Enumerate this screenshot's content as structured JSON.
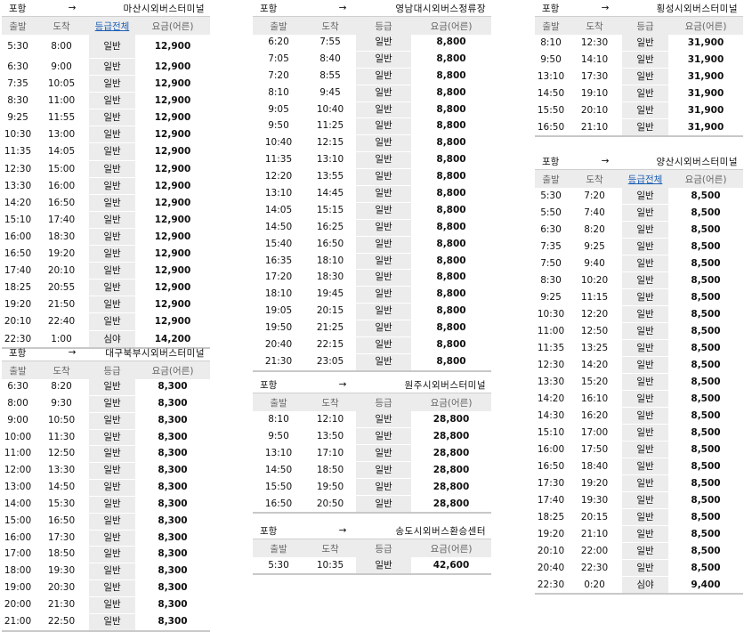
{
  "columns": {
    "dep": "출발",
    "arr": "도착",
    "grade": "등급",
    "grade_all": "등급전체",
    "fare": "요금(어른)"
  },
  "arrow": "→",
  "tables": [
    {
      "from": "포항",
      "dest": "마산시외버스터미널",
      "grade_link": true,
      "rows": [
        [
          "5:30",
          "8:00",
          "일반",
          "12,900"
        ],
        [
          "6:30",
          "9:00",
          "일반",
          "12,900"
        ],
        [
          "7:35",
          "10:05",
          "일반",
          "12,900"
        ],
        [
          "8:30",
          "11:00",
          "일반",
          "12,900"
        ],
        [
          "9:25",
          "11:55",
          "일반",
          "12,900"
        ],
        [
          "10:30",
          "13:00",
          "일반",
          "12,900"
        ],
        [
          "11:35",
          "14:05",
          "일반",
          "12,900"
        ],
        [
          "12:30",
          "15:00",
          "일반",
          "12,900"
        ],
        [
          "13:30",
          "16:00",
          "일반",
          "12,900"
        ],
        [
          "14:20",
          "16:50",
          "일반",
          "12,900"
        ],
        [
          "15:10",
          "17:40",
          "일반",
          "12,900"
        ],
        [
          "16:00",
          "18:30",
          "일반",
          "12,900"
        ],
        [
          "16:50",
          "19:20",
          "일반",
          "12,900"
        ],
        [
          "17:40",
          "20:10",
          "일반",
          "12,900"
        ],
        [
          "18:25",
          "20:55",
          "일반",
          "12,900"
        ],
        [
          "19:20",
          "21:50",
          "일반",
          "12,900"
        ],
        [
          "20:10",
          "22:40",
          "일반",
          "12,900"
        ],
        [
          "22:30",
          "1:00",
          "심야",
          "14,200"
        ]
      ]
    },
    {
      "from": "포항",
      "dest": "대구북부시외버스터미널",
      "grade_link": false,
      "rows": [
        [
          "6:30",
          "8:20",
          "일반",
          "8,300"
        ],
        [
          "8:00",
          "9:30",
          "일반",
          "8,300"
        ],
        [
          "9:00",
          "10:50",
          "일반",
          "8,300"
        ],
        [
          "10:00",
          "11:30",
          "일반",
          "8,300"
        ],
        [
          "11:00",
          "12:50",
          "일반",
          "8,300"
        ],
        [
          "12:00",
          "13:30",
          "일반",
          "8,300"
        ],
        [
          "13:00",
          "14:50",
          "일반",
          "8,300"
        ],
        [
          "14:00",
          "15:30",
          "일반",
          "8,300"
        ],
        [
          "15:00",
          "16:50",
          "일반",
          "8,300"
        ],
        [
          "16:00",
          "17:30",
          "일반",
          "8,300"
        ],
        [
          "17:00",
          "18:50",
          "일반",
          "8,300"
        ],
        [
          "18:00",
          "19:30",
          "일반",
          "8,300"
        ],
        [
          "19:00",
          "20:30",
          "일반",
          "8,300"
        ],
        [
          "20:00",
          "21:30",
          "일반",
          "8,300"
        ],
        [
          "21:00",
          "22:50",
          "일반",
          "8,300"
        ]
      ]
    },
    {
      "from": "포항",
      "dest": "영남대시외버스정류장",
      "grade_link": false,
      "rows": [
        [
          "6:20",
          "7:55",
          "일반",
          "8,800"
        ],
        [
          "7:05",
          "8:40",
          "일반",
          "8,800"
        ],
        [
          "7:20",
          "8:55",
          "일반",
          "8,800"
        ],
        [
          "8:10",
          "9:45",
          "일반",
          "8,800"
        ],
        [
          "9:05",
          "10:40",
          "일반",
          "8,800"
        ],
        [
          "9:50",
          "11:25",
          "일반",
          "8,800"
        ],
        [
          "10:40",
          "12:15",
          "일반",
          "8,800"
        ],
        [
          "11:35",
          "13:10",
          "일반",
          "8,800"
        ],
        [
          "12:20",
          "13:55",
          "일반",
          "8,800"
        ],
        [
          "13:10",
          "14:45",
          "일반",
          "8,800"
        ],
        [
          "14:05",
          "15:15",
          "일반",
          "8,800"
        ],
        [
          "14:50",
          "16:25",
          "일반",
          "8,800"
        ],
        [
          "15:40",
          "16:50",
          "일반",
          "8,800"
        ],
        [
          "16:35",
          "18:10",
          "일반",
          "8,800"
        ],
        [
          "17:20",
          "18:30",
          "일반",
          "8,800"
        ],
        [
          "18:10",
          "19:45",
          "일반",
          "8,800"
        ],
        [
          "19:05",
          "20:15",
          "일반",
          "8,800"
        ],
        [
          "19:50",
          "21:25",
          "일반",
          "8,800"
        ],
        [
          "20:40",
          "22:15",
          "일반",
          "8,800"
        ],
        [
          "21:30",
          "23:05",
          "일반",
          "8,800"
        ]
      ]
    },
    {
      "from": "포항",
      "dest": "원주시외버스터미널",
      "grade_link": false,
      "rows": [
        [
          "8:10",
          "12:10",
          "일반",
          "28,800"
        ],
        [
          "9:50",
          "13:50",
          "일반",
          "28,800"
        ],
        [
          "13:10",
          "17:10",
          "일반",
          "28,800"
        ],
        [
          "14:50",
          "18:50",
          "일반",
          "28,800"
        ],
        [
          "15:50",
          "19:50",
          "일반",
          "28,800"
        ],
        [
          "16:50",
          "20:50",
          "일반",
          "28,800"
        ]
      ]
    },
    {
      "from": "포항",
      "dest": "송도시외버스환승센터",
      "grade_link": false,
      "rows": [
        [
          "5:30",
          "10:35",
          "일반",
          "42,600"
        ]
      ]
    },
    {
      "from": "포항",
      "dest": "횡성시외버스터미널",
      "grade_link": false,
      "rows": [
        [
          "8:10",
          "12:30",
          "일반",
          "31,900"
        ],
        [
          "9:50",
          "14:10",
          "일반",
          "31,900"
        ],
        [
          "13:10",
          "17:30",
          "일반",
          "31,900"
        ],
        [
          "14:50",
          "19:10",
          "일반",
          "31,900"
        ],
        [
          "15:50",
          "20:10",
          "일반",
          "31,900"
        ],
        [
          "16:50",
          "21:10",
          "일반",
          "31,900"
        ]
      ]
    },
    {
      "from": "포항",
      "dest": "양산시외버스터미널",
      "grade_link": true,
      "rows": [
        [
          "5:30",
          "7:20",
          "일반",
          "8,500"
        ],
        [
          "5:50",
          "7:40",
          "일반",
          "8,500"
        ],
        [
          "6:30",
          "8:20",
          "일반",
          "8,500"
        ],
        [
          "7:35",
          "9:25",
          "일반",
          "8,500"
        ],
        [
          "7:50",
          "9:40",
          "일반",
          "8,500"
        ],
        [
          "8:30",
          "10:20",
          "일반",
          "8,500"
        ],
        [
          "9:25",
          "11:15",
          "일반",
          "8,500"
        ],
        [
          "10:30",
          "12:20",
          "일반",
          "8,500"
        ],
        [
          "11:00",
          "12:50",
          "일반",
          "8,500"
        ],
        [
          "11:35",
          "13:25",
          "일반",
          "8,500"
        ],
        [
          "12:30",
          "14:20",
          "일반",
          "8,500"
        ],
        [
          "13:30",
          "15:20",
          "일반",
          "8,500"
        ],
        [
          "14:20",
          "16:10",
          "일반",
          "8,500"
        ],
        [
          "14:30",
          "16:20",
          "일반",
          "8,500"
        ],
        [
          "15:10",
          "17:00",
          "일반",
          "8,500"
        ],
        [
          "16:00",
          "17:50",
          "일반",
          "8,500"
        ],
        [
          "16:50",
          "18:40",
          "일반",
          "8,500"
        ],
        [
          "17:30",
          "19:20",
          "일반",
          "8,500"
        ],
        [
          "17:40",
          "19:30",
          "일반",
          "8,500"
        ],
        [
          "18:25",
          "20:15",
          "일반",
          "8,500"
        ],
        [
          "19:20",
          "21:10",
          "일반",
          "8,500"
        ],
        [
          "20:10",
          "22:00",
          "일반",
          "8,500"
        ],
        [
          "20:40",
          "22:30",
          "일반",
          "8,500"
        ],
        [
          "22:30",
          "0:20",
          "심야",
          "9,400"
        ]
      ]
    }
  ]
}
